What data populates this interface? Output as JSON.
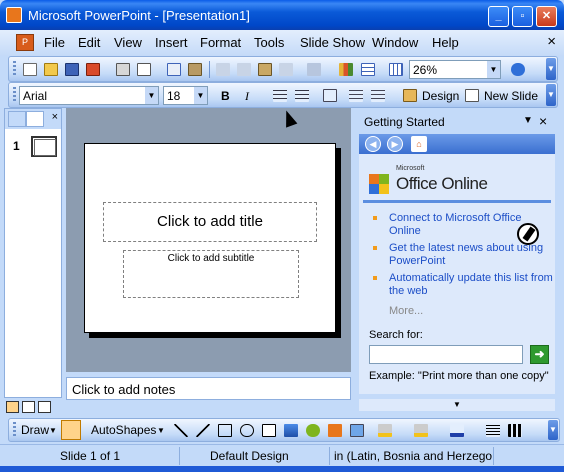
{
  "window": {
    "title": "Microsoft PowerPoint - [Presentation1]"
  },
  "menu": {
    "items": [
      "File",
      "Edit",
      "View",
      "Insert",
      "Format",
      "Tools",
      "Slide Show",
      "Window",
      "Help"
    ],
    "close": "×"
  },
  "standard_toolbar": {
    "zoom": "26%"
  },
  "formatting_toolbar": {
    "font": "Arial",
    "size": "18",
    "bold": "B",
    "italic": "I",
    "design": "Design",
    "new_slide": "New Slide"
  },
  "slides_pane": {
    "slide_number": "1"
  },
  "slide": {
    "title_placeholder": "Click to add title",
    "subtitle_placeholder": "Click to add subtitle"
  },
  "notes": {
    "placeholder": "Click to add notes"
  },
  "task_pane": {
    "title": "Getting Started",
    "logo_small": "Microsoft",
    "logo_text": "Office Online",
    "links": [
      "Connect to Microsoft Office Online",
      "Get the latest news about using PowerPoint",
      "Automatically update this list from the web"
    ],
    "more": "More...",
    "search_label": "Search for:",
    "search_value": "",
    "example": "Example:  \"Print more than one copy\""
  },
  "drawing_toolbar": {
    "draw": "Draw",
    "autoshapes": "AutoShapes"
  },
  "status_bar": {
    "slide": "Slide 1 of 1",
    "design": "Default Design",
    "language": "in (Latin, Bosnia and Herzego"
  },
  "icons": [
    "app-icon",
    "new-icon",
    "open-icon",
    "save-icon",
    "print-icon",
    "spelling-icon",
    "undo-icon",
    "chart-icon",
    "table-icon",
    "help-icon",
    "bullets-icon",
    "numbering-icon",
    "home-icon",
    "back-icon",
    "forward-icon",
    "go-arrow-icon",
    "select-arrow-icon"
  ],
  "colors": {
    "titlebar": "#0a5ad8",
    "toolbar": "#c5dbf8",
    "link": "#1c4ec7",
    "bullet": "#f29b1b"
  }
}
